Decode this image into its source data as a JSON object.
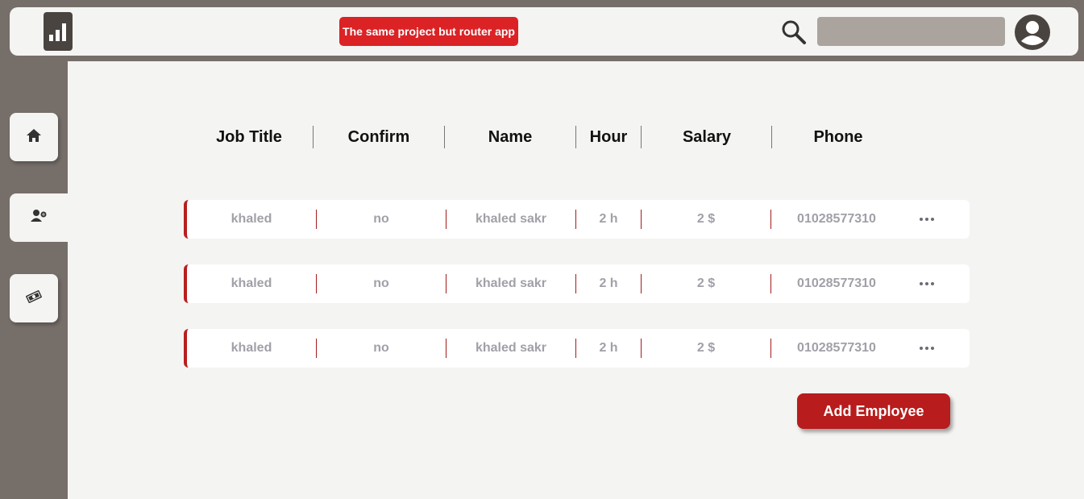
{
  "topbar": {
    "banner_label": "The same project but router app",
    "search_placeholder": "",
    "logo_icon": "bar-chart-icon",
    "search_icon": "search-icon",
    "avatar_icon": "user-avatar-icon"
  },
  "sidebar": {
    "items": [
      {
        "icon": "home-icon",
        "active": false
      },
      {
        "icon": "employees-icon",
        "active": true
      },
      {
        "icon": "money-icon",
        "active": false
      }
    ]
  },
  "table": {
    "headers": [
      "Job Title",
      "Confirm",
      "Name",
      "Hour",
      "Salary",
      "Phone"
    ],
    "rows": [
      {
        "job_title": "khaled",
        "confirm": "no",
        "name": "khaled sakr",
        "hour": "2 h",
        "salary": "2 $",
        "phone": "01028577310"
      },
      {
        "job_title": "khaled",
        "confirm": "no",
        "name": "khaled sakr",
        "hour": "2 h",
        "salary": "2 $",
        "phone": "01028577310"
      },
      {
        "job_title": "khaled",
        "confirm": "no",
        "name": "khaled sakr",
        "hour": "2 h",
        "salary": "2 $",
        "phone": "01028577310"
      }
    ]
  },
  "actions": {
    "add_employee_label": "Add Employee"
  },
  "colors": {
    "accent": "#b81c1c",
    "banner": "#db2225",
    "frame": "#766e69",
    "panel": "#f4f4f2"
  }
}
